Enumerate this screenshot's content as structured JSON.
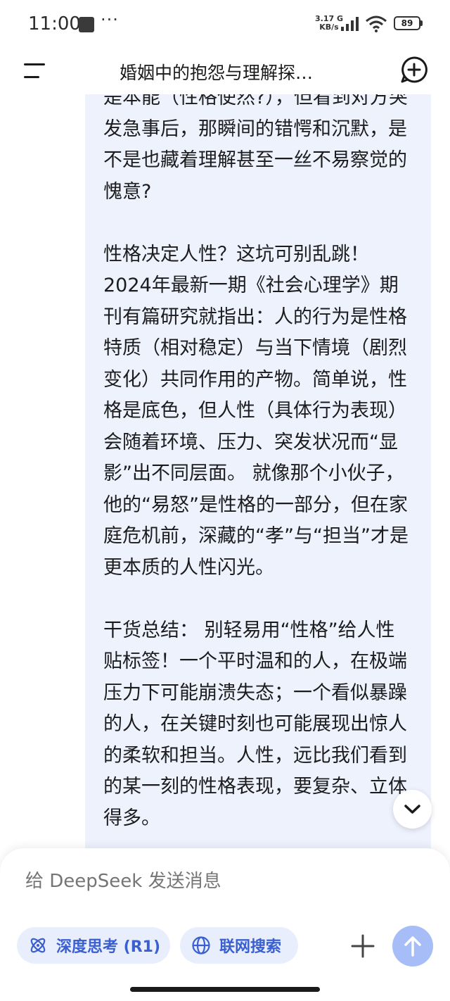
{
  "status_bar": {
    "time": "11:00",
    "dots": "···",
    "net_speed_value": "3.17 G",
    "net_speed_unit": "KB/s",
    "battery": "89"
  },
  "header": {
    "title": "婚姻中的抱怨与理解探…"
  },
  "message": {
    "paragraph_1": "是本能（性格使然?），但看到对方突发急事后，那瞬间的错愕和沉默，是不是也藏着理解甚至一丝不易察觉的愧意?",
    "paragraph_2": "性格决定人性？这坑可别乱跳！2024年最新一期《社会心理学》期刊有篇研究就指出：人的行为是性格特质（相对稳定）与当下情境（剧烈变化）共同作用的产物。简单说，性格是底色，但人性（具体行为表现）会随着环境、压力、突发状况而“显影”出不同层面。 就像那个小伙子，他的“易怒”是性格的一部分，但在家庭危机前，深藏的“孝”与“担当”才是更本质的人性闪光。",
    "paragraph_3": "干货总结： 别轻易用“性格”给人性贴标签！一个平时温和的人，在极端压力下可能崩溃失态；一个看似暴躁的人，在关键时刻也可能展现出惊人的柔软和担当。人性，远比我们看到的某一刻的性格表现，要复杂、立体得多。"
  },
  "composer": {
    "placeholder": "给 DeepSeek 发送消息",
    "deepthink_label": "深度思考 (R1)",
    "search_label": "联网搜索"
  },
  "colors": {
    "accent": "#3a5fd0",
    "bubble_bg": "#eef2fd",
    "send_button": "#a6bdf7"
  }
}
